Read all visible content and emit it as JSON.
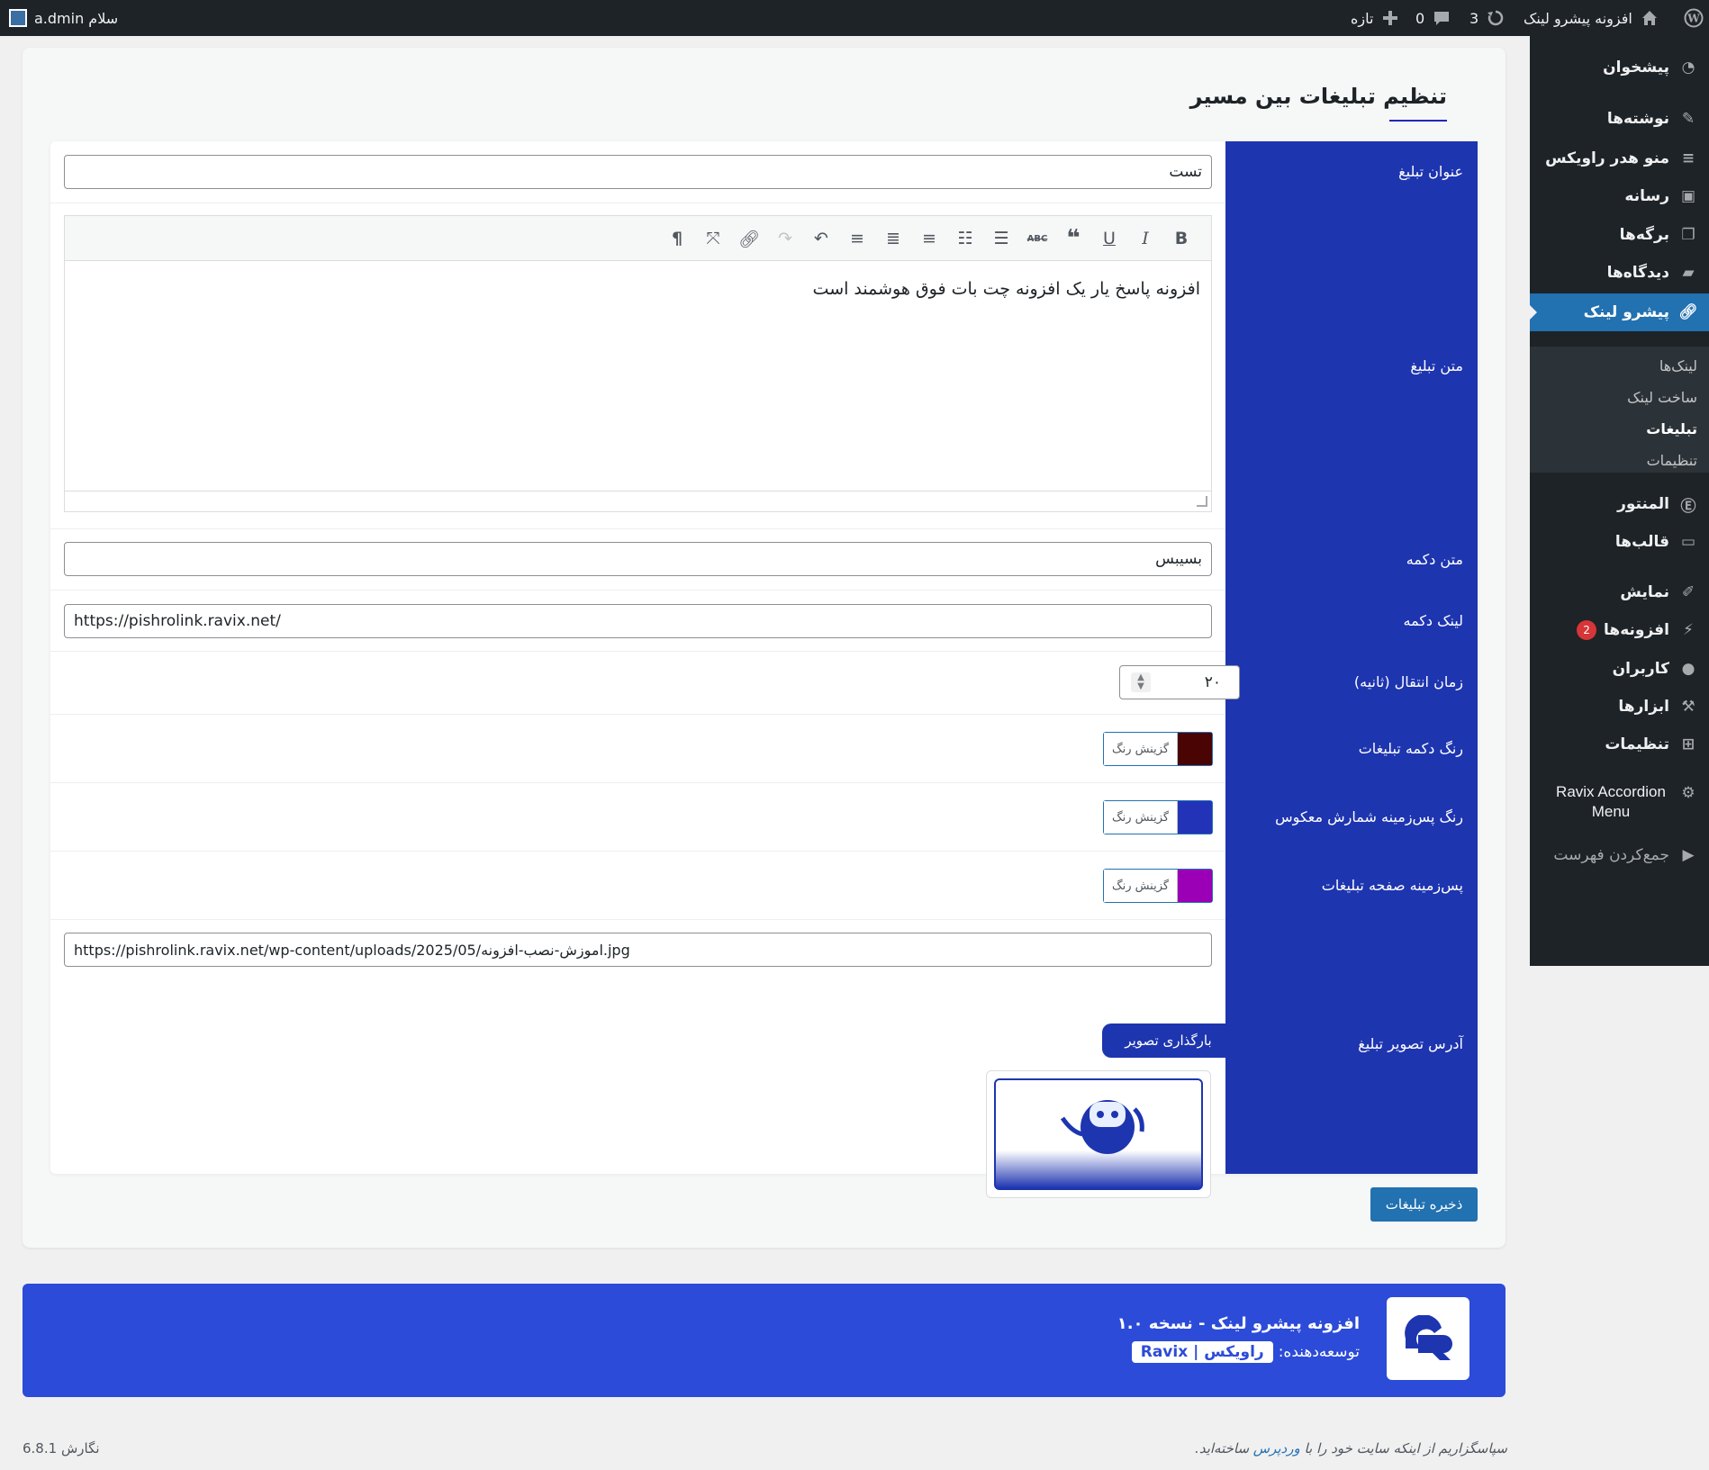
{
  "adminbar": {
    "site_name": "افزونه پیشرو لینک",
    "updates_count": "3",
    "comments_count": "0",
    "new_label": "تازه",
    "greeting": "سلام a.dmin"
  },
  "sidebar": {
    "items": [
      {
        "label": "پیشخوان",
        "icon": "dashboard-icon"
      },
      {
        "label": "نوشته‌ها",
        "icon": "pin-icon"
      },
      {
        "label": "منو هدر راویکس",
        "icon": "menu-icon"
      },
      {
        "label": "رسانه",
        "icon": "media-icon"
      },
      {
        "label": "برگه‌ها",
        "icon": "pages-icon"
      },
      {
        "label": "دیدگاه‌ها",
        "icon": "comments-icon"
      },
      {
        "label": "پیشرو لینک",
        "icon": "link-icon"
      },
      {
        "label": "المنتور",
        "icon": "elementor-icon"
      },
      {
        "label": "قالب‌ها",
        "icon": "folder-icon"
      },
      {
        "label": "نمایش",
        "icon": "brush-icon"
      },
      {
        "label": "افزونه‌ها",
        "icon": "plugins-icon",
        "badge": "2"
      },
      {
        "label": "کاربران",
        "icon": "users-icon"
      },
      {
        "label": "ابزارها",
        "icon": "tools-icon"
      },
      {
        "label": "تنظیمات",
        "icon": "settings-icon"
      },
      {
        "label": "Ravix Accordion Menu",
        "icon": "gear-icon"
      },
      {
        "label": "جمع‌کردن فهرست",
        "icon": "collapse-icon"
      }
    ],
    "submenu": [
      "لینک‌ها",
      "ساخت لینک",
      "تبلیغات",
      "تنظیمات"
    ]
  },
  "page": {
    "title": "تنظیم تبلیغات بین مسیر"
  },
  "form": {
    "ad_title_label": "عنوان تبلیغ",
    "ad_title_value": "تست",
    "ad_text_label": "متن تبلیغ",
    "ad_text_value": "افزونه پاسخ یار یک افزونه چت بات فوق هوشمند است",
    "button_text_label": "متن دکمه",
    "button_text_value": "بسیبس",
    "button_link_label": "لینک دکمه",
    "button_link_value": "https://pishrolink.ravix.net/",
    "transition_label": "زمان انتقال (ثانیه)",
    "transition_value": "۲۰",
    "button_color_label": "رنگ دکمه تبلیغات",
    "countdown_bg_label": "رنگ پس‌زمینه شمارش معکوس",
    "page_bg_label": "پس‌زمینه صفحه تبلیغات",
    "pick_color_label": "گزینش رنگ",
    "button_color": "#4a0404",
    "countdown_color": "#2333b8",
    "page_bg_color": "#9b00b7",
    "image_label": "آدرس تصویر تبلیغ",
    "image_url": "https://pishrolink.ravix.net/wp-content/uploads/2025/05/اموزش-نصب-افزونه.jpg",
    "upload_button": "بارگذاری تصویر",
    "save_button": "ذخیره تبلیغات"
  },
  "banner": {
    "title": "افزونه پیشرو لینک - نسخه ۱.۰",
    "developer_label": "توسعه‌دهنده:",
    "developer_name": "راویکس | Ravix"
  },
  "footer": {
    "thanks_prefix": "سپاسگزاریم از اینکه سایت خود را با",
    "wordpress_link": "وردپرس",
    "thanks_suffix": "ساخته‌اید.",
    "version": "نگارش 6.8.1"
  },
  "colors": {
    "accent": "#1e35b0",
    "wp_blue": "#2271b1",
    "adminbar_bg": "#1d2327",
    "banner_bg": "#2c4bd8"
  }
}
